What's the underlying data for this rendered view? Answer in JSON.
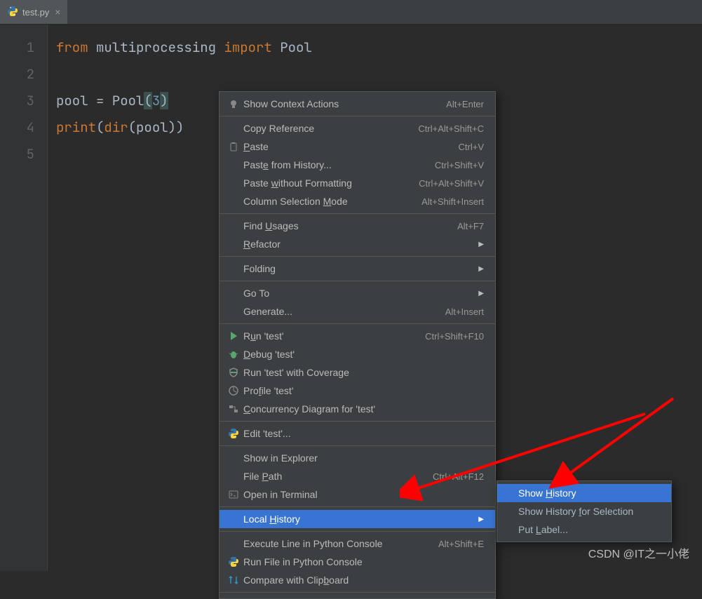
{
  "tab": {
    "filename": "test.py"
  },
  "gutter": {
    "lines": [
      "1",
      "2",
      "3",
      "4",
      "5"
    ]
  },
  "code": {
    "l1_from": "from ",
    "l1_mod": "multiprocessing ",
    "l1_import": "import ",
    "l1_name": "Pool",
    "l3_a": "pool = Pool",
    "l3_p1": "(",
    "l3_num": "3",
    "l3_p2": ")",
    "l4_a": "print",
    "l4_b": "(",
    "l4_c": "dir",
    "l4_d": "(pool))"
  },
  "ctx": [
    {
      "t": "item",
      "icon": "bulb",
      "label": "Show Context Actions",
      "sc": "Alt+Enter"
    },
    {
      "t": "sep"
    },
    {
      "t": "item",
      "label": "Copy Reference",
      "sc": "Ctrl+Alt+Shift+C"
    },
    {
      "t": "item",
      "icon": "clipboard",
      "label_html": "<span class='u'>P</span>aste",
      "sc": "Ctrl+V"
    },
    {
      "t": "item",
      "label_html": "Past<span class='u'>e</span> from History...",
      "sc": "Ctrl+Shift+V"
    },
    {
      "t": "item",
      "label_html": "Paste <span class='u'>w</span>ithout Formatting",
      "sc": "Ctrl+Alt+Shift+V"
    },
    {
      "t": "item",
      "label_html": "Column Selection <span class='u'>M</span>ode",
      "sc": "Alt+Shift+Insert"
    },
    {
      "t": "sep"
    },
    {
      "t": "item",
      "label_html": "Find <span class='u'>U</span>sages",
      "sc": "Alt+F7"
    },
    {
      "t": "item",
      "label_html": "<span class='u'>R</span>efactor",
      "sub": true
    },
    {
      "t": "sep"
    },
    {
      "t": "item",
      "label": "Folding",
      "sub": true
    },
    {
      "t": "sep"
    },
    {
      "t": "item",
      "label": "Go To",
      "sub": true
    },
    {
      "t": "item",
      "label": "Generate...",
      "sc": "Alt+Insert"
    },
    {
      "t": "sep"
    },
    {
      "t": "item",
      "icon": "run",
      "label_html": "R<span class='u'>u</span>n 'test'",
      "sc": "Ctrl+Shift+F10"
    },
    {
      "t": "item",
      "icon": "bug",
      "label_html": "<span class='u'>D</span>ebug 'test'"
    },
    {
      "t": "item",
      "icon": "coverage",
      "label": "Run 'test' with Coverage"
    },
    {
      "t": "item",
      "icon": "profile",
      "label_html": "Pro<span class='u'>f</span>ile 'test'"
    },
    {
      "t": "item",
      "icon": "concurrency",
      "label_html": "<span class='u'>C</span>oncurrency Diagram for 'test'"
    },
    {
      "t": "sep"
    },
    {
      "t": "item",
      "icon": "python",
      "label": "Edit 'test'..."
    },
    {
      "t": "sep"
    },
    {
      "t": "item",
      "label": "Show in Explorer"
    },
    {
      "t": "item",
      "label_html": "File <span class='u'>P</span>ath",
      "sc": "Ctrl+Alt+F12"
    },
    {
      "t": "item",
      "icon": "terminal",
      "label": "Open in Terminal"
    },
    {
      "t": "sep"
    },
    {
      "t": "item",
      "selected": true,
      "label_html": "Local <span class='u'>H</span>istory",
      "sub": true
    },
    {
      "t": "sep"
    },
    {
      "t": "item",
      "label": "Execute Line in Python Console",
      "sc": "Alt+Shift+E"
    },
    {
      "t": "item",
      "icon": "python",
      "label": "Run File in Python Console"
    },
    {
      "t": "item",
      "icon": "compare",
      "label_html": "Compare with Clip<span class='u'>b</span>oard"
    },
    {
      "t": "sep"
    }
  ],
  "submenu": [
    {
      "selected": true,
      "label_html": "Show <span class='u'>H</span>istory"
    },
    {
      "label_html": "Show History <span class='u'>f</span>or Selection"
    },
    {
      "label_html": "Put <span class='u'>L</span>abel..."
    }
  ],
  "watermark": "CSDN @IT之一小佬"
}
